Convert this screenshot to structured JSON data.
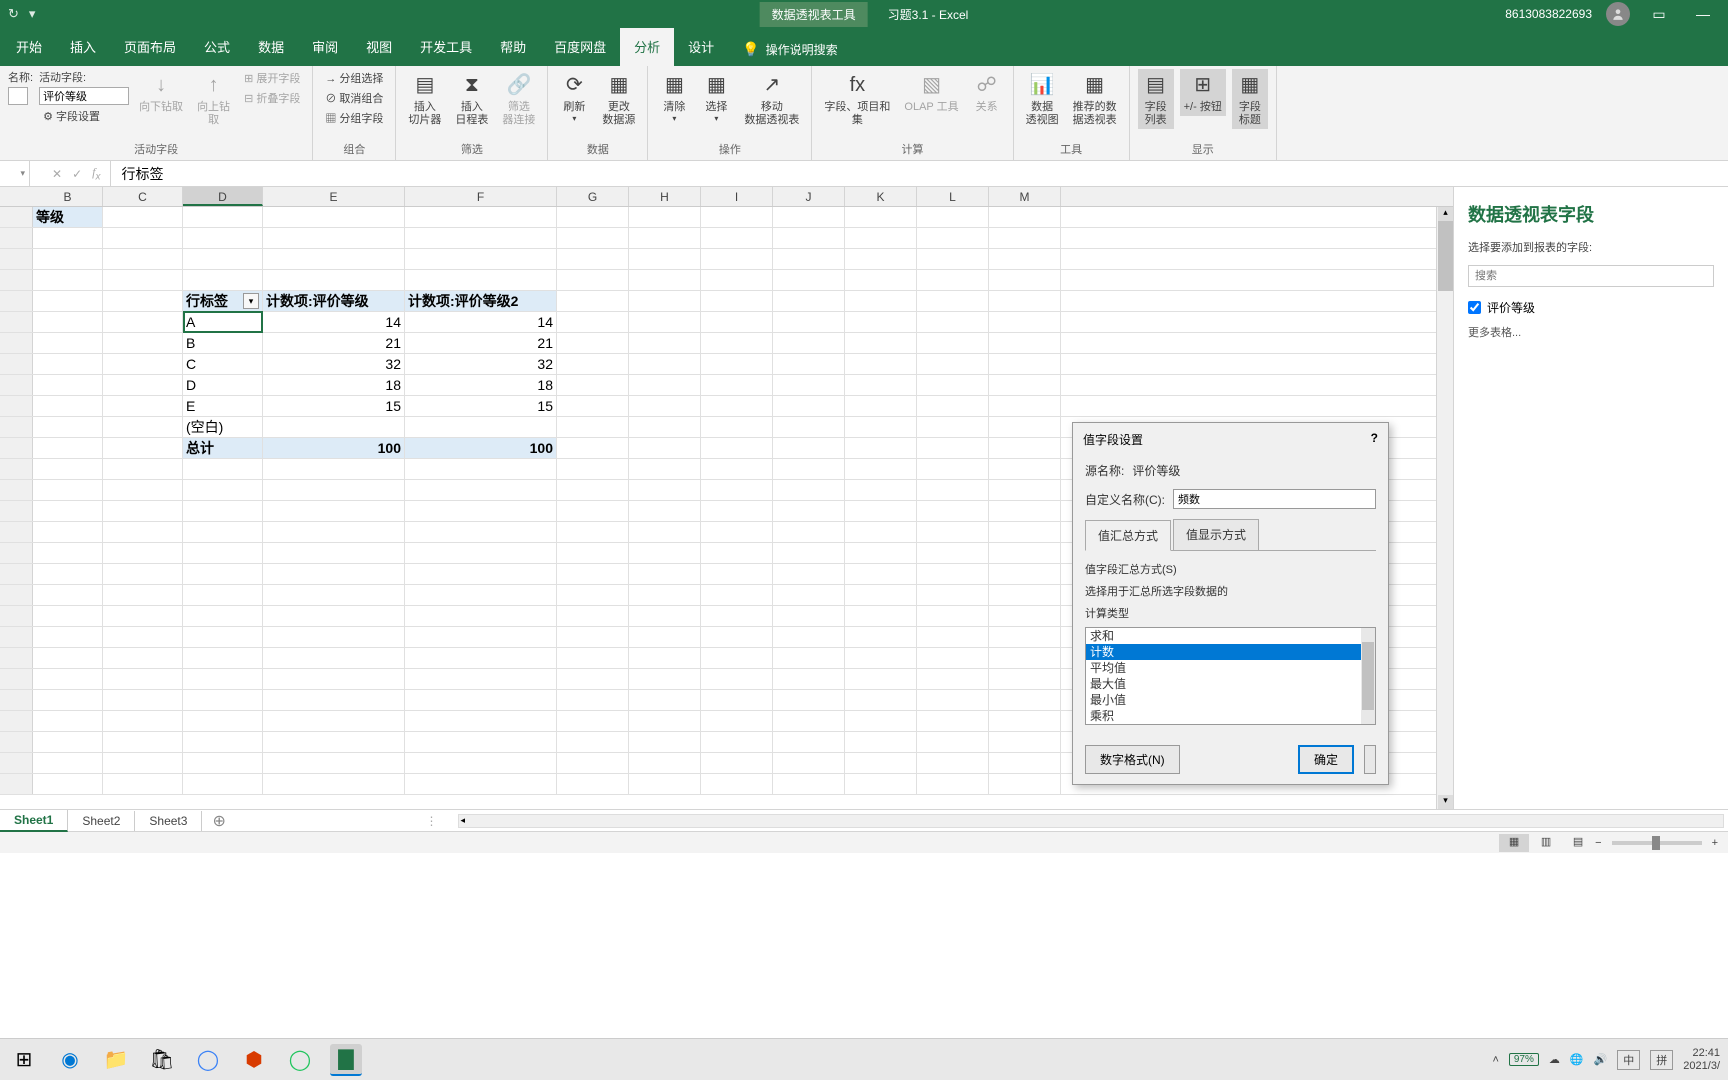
{
  "titlebar": {
    "context_tool": "数据透视表工具",
    "doc": "习题3.1  -  Excel",
    "user": "8613083822693"
  },
  "tabs": [
    "开始",
    "插入",
    "页面布局",
    "公式",
    "数据",
    "审阅",
    "视图",
    "开发工具",
    "帮助",
    "百度网盘",
    "分析",
    "设计"
  ],
  "active_tab": "分析",
  "tell_me": "操作说明搜索",
  "ribbon": {
    "g1": {
      "name_label": "名称:",
      "active_label": "活动字段:",
      "active_value": "评价等级",
      "setting": "字段设置",
      "drill_down": "向下钻取",
      "drill_up": "向上钻\n取",
      "expand": "展开字段",
      "collapse": "折叠字段",
      "group": "活动字段"
    },
    "g2": {
      "sel": "分组选择",
      "cancel": "取消组合",
      "field": "分组字段",
      "group": "组合"
    },
    "g3": {
      "slicer": "插入\n切片器",
      "timeline": "插入\n日程表",
      "conn": "筛选\n器连接",
      "group": "筛选"
    },
    "g4": {
      "refresh": "刷新",
      "source": "更改\n数据源",
      "group": "数据"
    },
    "g5": {
      "clear": "清除",
      "select": "选择",
      "move": "移动\n数据透视表",
      "group": "操作"
    },
    "g6": {
      "fields": "字段、项目和\n集",
      "olap": "OLAP 工具",
      "rel": "关系",
      "group": "计算"
    },
    "g7": {
      "chart": "数据\n透视图",
      "rec": "推荐的数\n据透视表",
      "group": "工具"
    },
    "g8": {
      "list": "字段\n列表",
      "pm": "+/- 按钮",
      "head": "字段\n标题",
      "group": "显示"
    }
  },
  "formula": {
    "value": "行标签"
  },
  "columns": [
    "B",
    "C",
    "D",
    "E",
    "F",
    "G",
    "H",
    "I",
    "J",
    "K",
    "L",
    "M"
  ],
  "pivot": {
    "lvl_header": "等级",
    "row_label": "行标签",
    "col1": "计数项:评价等级",
    "col2": "计数项:评价等级2",
    "rows": [
      {
        "k": "A",
        "v1": 14,
        "v2": 14
      },
      {
        "k": "B",
        "v1": 21,
        "v2": 21
      },
      {
        "k": "C",
        "v1": 32,
        "v2": 32
      },
      {
        "k": "D",
        "v1": 18,
        "v2": 18
      },
      {
        "k": "E",
        "v1": 15,
        "v2": 15
      },
      {
        "k": "(空白)",
        "v1": "",
        "v2": ""
      }
    ],
    "total_label": "总计",
    "total1": 100,
    "total2": 100
  },
  "fieldpane": {
    "title": "数据透视表字段",
    "sub": "选择要添加到报表的字段:",
    "search": "搜索",
    "field": "评价等级",
    "more": "更多表格..."
  },
  "dialog": {
    "title": "值字段设置",
    "source_label": "源名称:",
    "source": "评价等级",
    "custom_label": "自定义名称(C):",
    "custom": "频数",
    "tab1": "值汇总方式",
    "tab2": "值显示方式",
    "method_label1": "值字段汇总方式(S)",
    "method_label2": "选择用于汇总所选字段数据的",
    "method_label3": "计算类型",
    "opts": [
      "求和",
      "计数",
      "平均值",
      "最大值",
      "最小值",
      "乘积"
    ],
    "selected_idx": 1,
    "num_format": "数字格式(N)",
    "ok": "确定"
  },
  "sheets": [
    "Sheet1",
    "Sheet2",
    "Sheet3"
  ],
  "status": {
    "zoom": "97%"
  },
  "taskbar": {
    "battery": "97%",
    "ime1": "中",
    "ime2": "拼",
    "time": "22:41",
    "date": "2021/3/"
  }
}
